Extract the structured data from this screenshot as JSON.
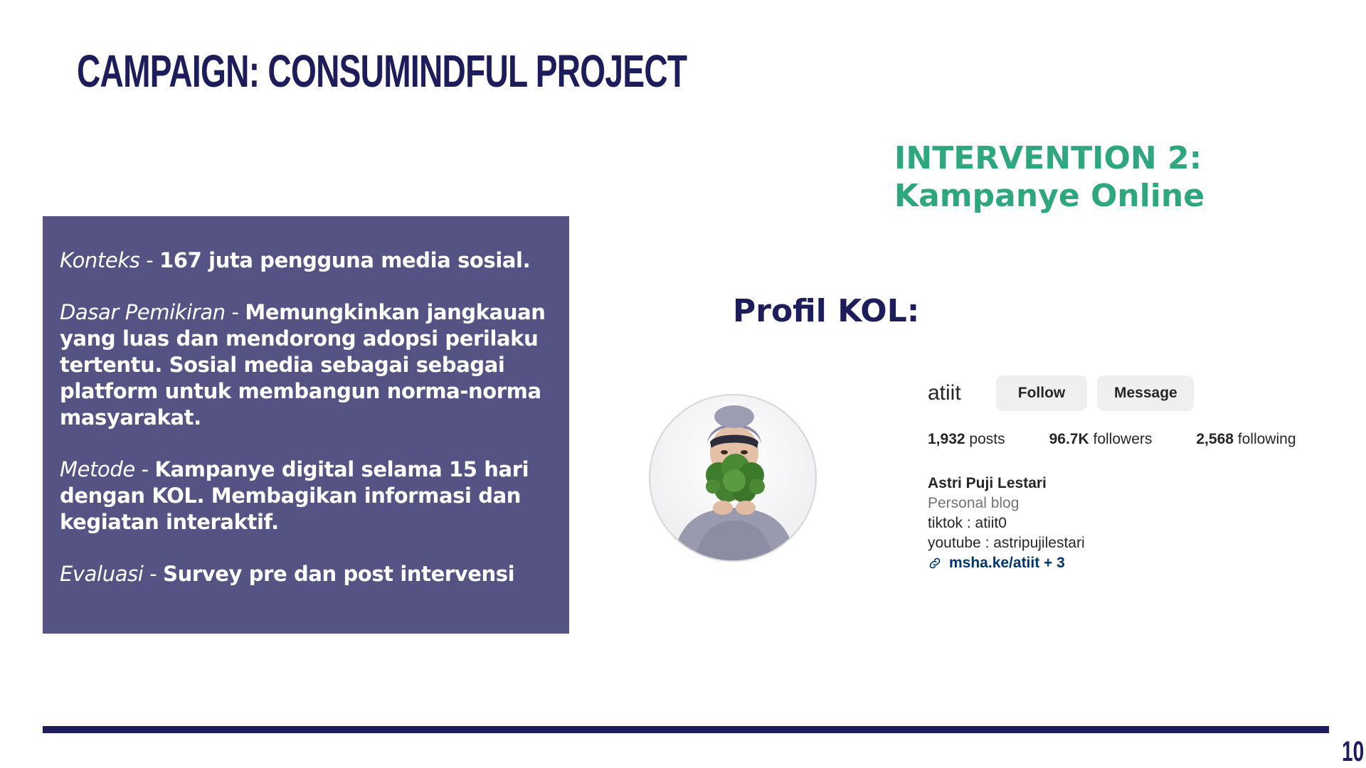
{
  "slide": {
    "title": "Campaign: Consumindful Project",
    "page_number": "10"
  },
  "info_box": {
    "items": [
      {
        "key": "Konteks",
        "separator": " - ",
        "value": "167 juta pengguna media sosial."
      },
      {
        "key": "Dasar Pemikiran",
        "separator": " - ",
        "value": "Memungkinkan jangkauan yang luas dan mendorong adopsi perilaku tertentu. Sosial media sebagai sebagai platform untuk membangun norma-norma masyarakat."
      },
      {
        "key": "Metode",
        "separator": " - ",
        "value": "Kampanye digital selama 15 hari dengan KOL. Membagikan informasi dan kegiatan interaktif."
      },
      {
        "key": "Evaluasi",
        "separator": " - ",
        "value": "Survey pre dan post intervensi"
      }
    ]
  },
  "intervention": {
    "line1": "INTERVENTION 2:",
    "line2": "Kampanye Online"
  },
  "kol": {
    "heading": "Profil KOL:"
  },
  "profile": {
    "username": "atiit",
    "follow_label": "Follow",
    "message_label": "Message",
    "posts_count": "1,932",
    "posts_label": "posts",
    "followers_count": "96.7K",
    "followers_label": "followers",
    "following_count": "2,568",
    "following_label": "following",
    "name": "Astri Puji Lestari",
    "category": "Personal blog",
    "bio_line1": "tiktok : atiit0",
    "bio_line2": "youtube : astripujilestari",
    "link": "msha.ke/atiit + 3"
  },
  "colors": {
    "navy": "#1e1d5c",
    "box_purple": "#545383",
    "green": "#2ea67e",
    "link_blue": "#00376b"
  }
}
